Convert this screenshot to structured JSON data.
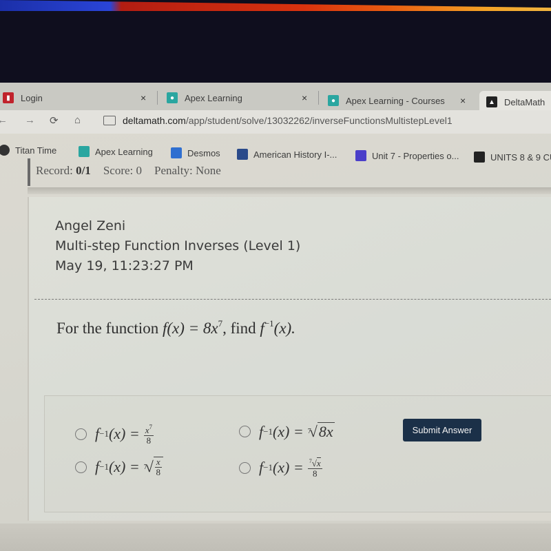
{
  "browser": {
    "tabs": [
      {
        "title": "Login",
        "icon": "login-favicon",
        "color": "#c0222b"
      },
      {
        "title": "Apex Learning",
        "icon": "apex-favicon",
        "color": "#2aa6a0"
      },
      {
        "title": "Apex Learning - Courses",
        "icon": "apex-favicon",
        "color": "#2aa6a0"
      },
      {
        "title": "DeltaMath",
        "icon": "deltamath-favicon",
        "color": "#222222"
      }
    ],
    "close_glyph": "×",
    "url_host": "deltamath.com",
    "url_path": "/app/student/solve/13032262/inverseFunctionsMultistepLevel1",
    "nav": {
      "back": "←",
      "forward": "→",
      "reload": "⟳",
      "home": "⌂"
    },
    "bookmarks": [
      {
        "label": "Titan Time",
        "icon": "titan-time-icon",
        "color": "#333333"
      },
      {
        "label": "Apex Learning",
        "icon": "apex-favicon",
        "color": "#2aa6a0"
      },
      {
        "label": "Desmos",
        "icon": "desmos-icon",
        "color": "#2f6fd0"
      },
      {
        "label": "American History I-...",
        "icon": "book-icon",
        "color": "#2a4a8a"
      },
      {
        "label": "Unit 7 - Properties o...",
        "icon": "forms-icon",
        "color": "#4b3fc9"
      },
      {
        "label": "UNITS 8 & 9 CU",
        "icon": "classroom-icon",
        "color": "#222222"
      }
    ]
  },
  "record": {
    "record_label": "Record:",
    "record_value": "0/1",
    "score_label": "Score:",
    "score_value": "0",
    "penalty_label": "Penalty:",
    "penalty_value": "None"
  },
  "problem": {
    "student_name": "Angel Zeni",
    "assignment": "Multi-step Function Inverses (Level 1)",
    "timestamp": "May 19, 11:23:27 PM",
    "question_prefix": "For the function ",
    "question_function": "f(x) = 8x",
    "question_exponent": "7",
    "question_mid": ", find ",
    "question_target": "f",
    "question_target_exp": "−1",
    "question_target_arg": "(x).",
    "choices": [
      {
        "lhs": "f",
        "lhs_exp": "−1",
        "lhs_arg": "(x) = ",
        "rhs": "x^7 / 8",
        "num": "x",
        "num_exp": "7",
        "den": "8"
      },
      {
        "lhs": "f",
        "lhs_exp": "−1",
        "lhs_arg": "(x) = ",
        "rhs": "7th-root(8x)",
        "index": "7",
        "radicand": "8x"
      },
      {
        "lhs": "f",
        "lhs_exp": "−1",
        "lhs_arg": "(x) = ",
        "rhs": "7th-root(x/8)",
        "index": "7",
        "num": "x",
        "den": "8"
      },
      {
        "lhs": "f",
        "lhs_exp": "−1",
        "lhs_arg": "(x) = ",
        "rhs": "7th-root(x) / 8",
        "index": "7",
        "radicand": "x",
        "den": "8"
      }
    ],
    "submit_label": "Submit Answer",
    "submit_color": "#1b3048"
  }
}
